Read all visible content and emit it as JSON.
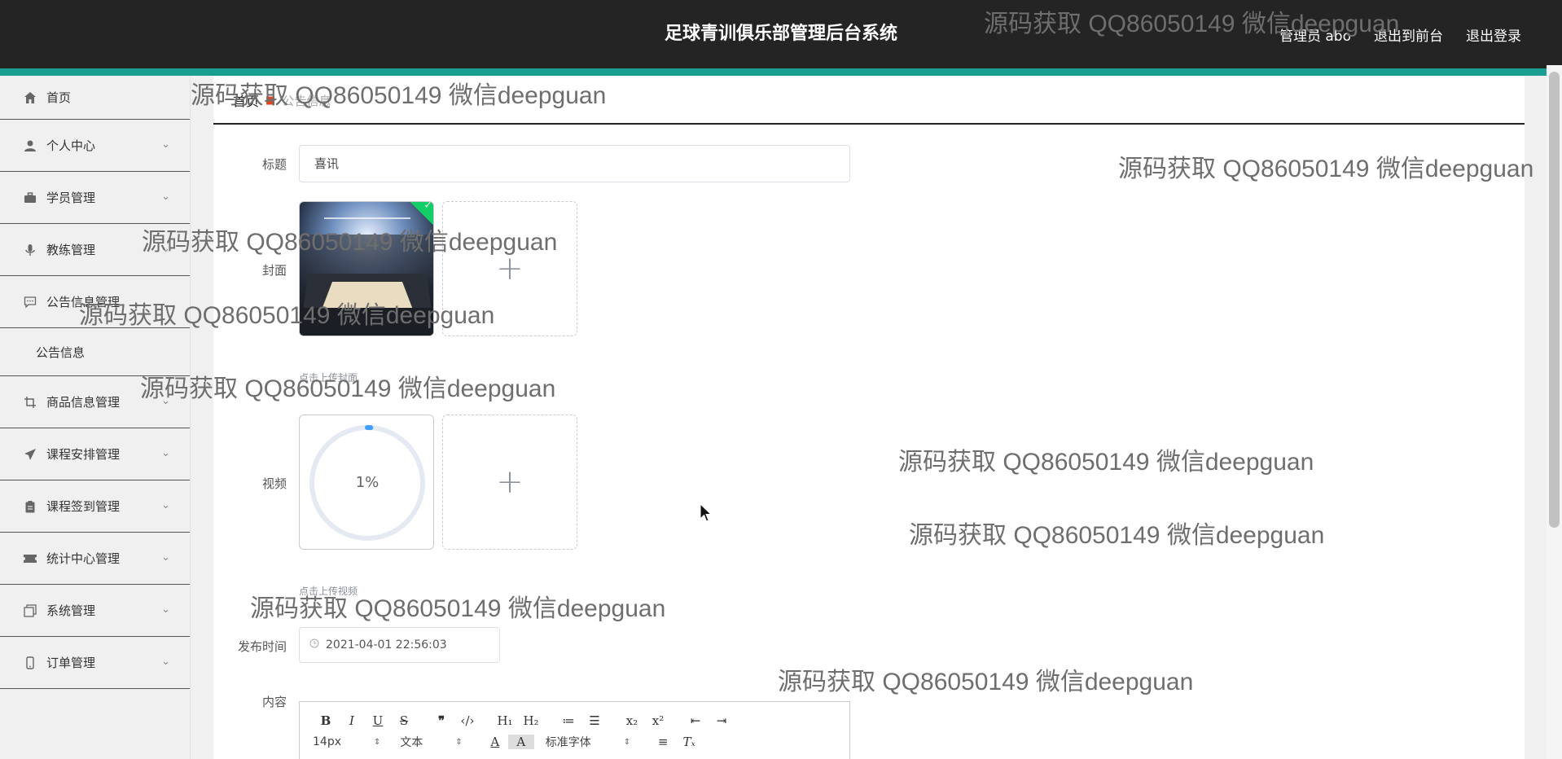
{
  "header": {
    "app_title": "足球青训俱乐部管理后台系统",
    "user_label": "管理员 abo",
    "to_front_label": "退出到前台",
    "logout_label": "退出登录"
  },
  "sidebar": {
    "items": [
      {
        "label": "首页",
        "icon": "home-icon"
      },
      {
        "label": "个人中心",
        "icon": "user-icon"
      },
      {
        "label": "学员管理",
        "icon": "briefcase-icon"
      },
      {
        "label": "教练管理",
        "icon": "microphone-icon"
      },
      {
        "label": "公告信息管理",
        "icon": "chat-icon"
      },
      {
        "label": "商品信息管理",
        "icon": "crop-icon"
      },
      {
        "label": "课程安排管理",
        "icon": "send-icon"
      },
      {
        "label": "课程签到管理",
        "icon": "clipboard-icon"
      },
      {
        "label": "统计中心管理",
        "icon": "ticket-icon"
      },
      {
        "label": "系统管理",
        "icon": "copy-icon"
      },
      {
        "label": "订单管理",
        "icon": "phone-icon"
      }
    ],
    "sub_item": "公告信息"
  },
  "breadcrumb": {
    "home": "首页",
    "current": "公告信息"
  },
  "form": {
    "title_label": "标题",
    "title_value": "喜讯",
    "cover_label": "封面",
    "cover_tip": "点击上传封面",
    "video_label": "视频",
    "video_progress": "1%",
    "video_progress_value": 0.01,
    "video_tip": "点击上传视频",
    "publish_label": "发布时间",
    "publish_value": "2021-04-01 22:56:03",
    "content_label": "内容"
  },
  "editor": {
    "font_size": "14px",
    "text_style": "文本",
    "font_family": "标准字体"
  },
  "watermark_text": "源码获取 QQ86050149 微信deepguan",
  "colors": {
    "header_bg": "#242424",
    "accent": "#1a9e92",
    "success": "#13ce66",
    "progress": "#409eff"
  }
}
